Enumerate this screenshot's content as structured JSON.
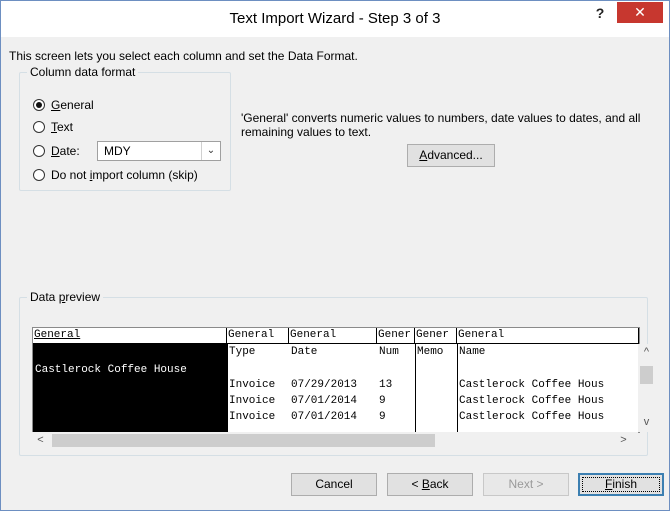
{
  "window": {
    "title": "Text Import Wizard - Step 3 of 3",
    "help": "?",
    "close": "✕"
  },
  "intro": "This screen lets you select each column and set the Data Format.",
  "format": {
    "legend": "Column data format",
    "options": [
      {
        "pre": "",
        "key": "G",
        "post": "eneral",
        "checked": true
      },
      {
        "pre": "",
        "key": "T",
        "post": "ext",
        "checked": false
      },
      {
        "pre": "",
        "key": "D",
        "post": "ate:",
        "checked": false
      },
      {
        "pre": "Do not ",
        "key": "i",
        "post": "mport column (skip)",
        "checked": false
      }
    ],
    "date_value": "MDY",
    "description": "'General' converts numeric values to numbers, date values to dates, and all remaining values to text.",
    "advanced": {
      "key": "A",
      "post": "dvanced..."
    }
  },
  "preview": {
    "legend_pre": "Data ",
    "legend_key": "p",
    "legend_post": "review",
    "headers": [
      "General",
      "General",
      "General",
      "Gener",
      "Gener",
      "General"
    ],
    "selected_column": 0,
    "rows": [
      [
        "",
        "Type",
        "Date",
        "Num",
        "Memo",
        "Name"
      ],
      [
        "Castlerock Coffee House",
        "",
        "",
        "",
        "",
        ""
      ],
      [
        "",
        "Invoice",
        "07/29/2013",
        "13",
        "",
        "Castlerock Coffee Hous"
      ],
      [
        "",
        "Invoice",
        "07/01/2014",
        "9",
        "",
        "Castlerock Coffee Hous"
      ],
      [
        "",
        "Invoice",
        "07/01/2014",
        "9",
        "",
        "Castlerock Coffee Hous"
      ]
    ]
  },
  "buttons": {
    "cancel": "Cancel",
    "back_pre": "< ",
    "back_key": "B",
    "back_post": "ack",
    "next": "Next >",
    "finish_key": "F",
    "finish_post": "inish"
  },
  "scroll": {
    "up": "^",
    "down": "v",
    "left": "<",
    "right": ">"
  }
}
